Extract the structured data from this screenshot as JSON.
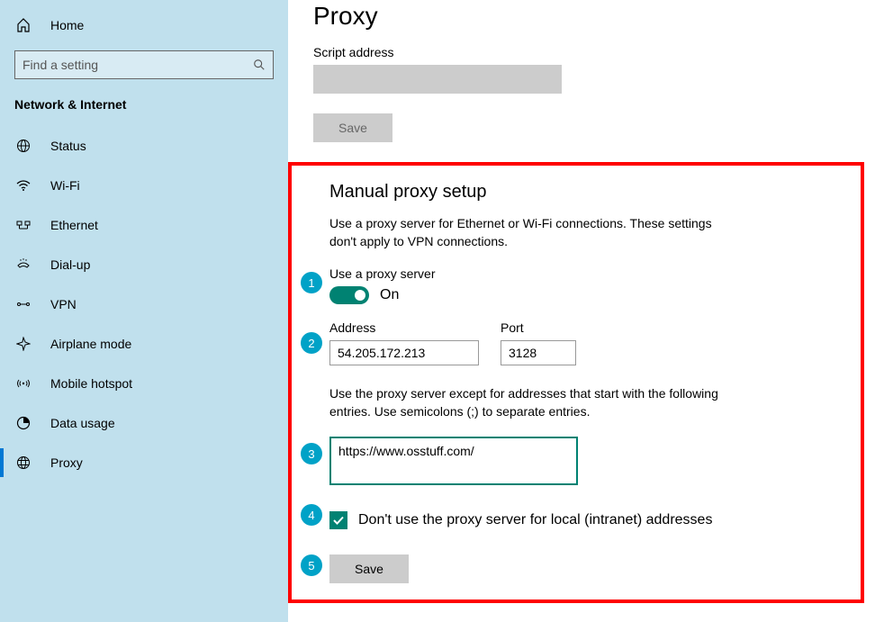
{
  "sidebar": {
    "home": "Home",
    "search_placeholder": "Find a setting",
    "section": "Network & Internet",
    "items": [
      {
        "label": "Status"
      },
      {
        "label": "Wi-Fi"
      },
      {
        "label": "Ethernet"
      },
      {
        "label": "Dial-up"
      },
      {
        "label": "VPN"
      },
      {
        "label": "Airplane mode"
      },
      {
        "label": "Mobile hotspot"
      },
      {
        "label": "Data usage"
      },
      {
        "label": "Proxy"
      }
    ]
  },
  "main": {
    "title": "Proxy",
    "script_label": "Script address",
    "script_value": "",
    "save1": "Save",
    "section_title": "Manual proxy setup",
    "section_desc": "Use a proxy server for Ethernet or Wi-Fi connections. These settings don't apply to VPN connections.",
    "use_proxy_label": "Use a proxy server",
    "toggle_state": "On",
    "address_label": "Address",
    "address_value": "54.205.172.213",
    "port_label": "Port",
    "port_value": "3128",
    "exceptions_desc": "Use the proxy server except for addresses that start with the following entries. Use semicolons (;) to separate entries.",
    "exceptions_value": "https://www.osstuff.com/",
    "local_cb_label": "Don't use the proxy server for local (intranet) addresses",
    "save2": "Save",
    "badges": [
      "1",
      "2",
      "3",
      "4",
      "5"
    ]
  }
}
